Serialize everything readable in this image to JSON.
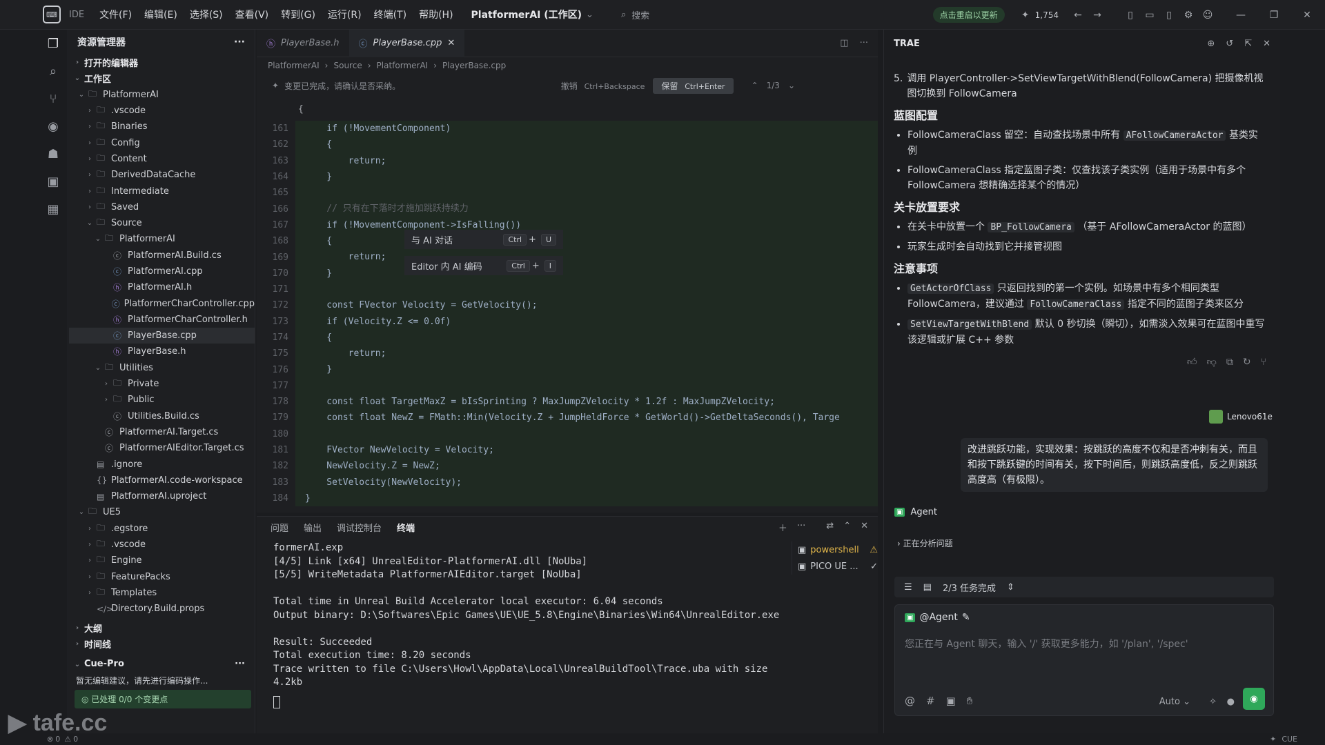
{
  "titlebar": {
    "ide_label": "IDE",
    "menu": [
      "文件(F)",
      "编辑(E)",
      "选择(S)",
      "查看(V)",
      "转到(G)",
      "运行(R)",
      "终端(T)",
      "帮助(H)"
    ],
    "project": "PlatformerAI (工作区)",
    "search": "搜索",
    "update": "点击重启以更新",
    "stars": "1,754"
  },
  "sidebar": {
    "title": "资源管理器",
    "open_editors": "打开的编辑器",
    "workspace": "工作区",
    "tree": [
      {
        "name": "PlatformerAI",
        "type": "folder",
        "indent": 1,
        "open": true
      },
      {
        "name": ".vscode",
        "type": "folder",
        "indent": 2
      },
      {
        "name": "Binaries",
        "type": "folder",
        "indent": 2
      },
      {
        "name": "Config",
        "type": "folder",
        "indent": 2
      },
      {
        "name": "Content",
        "type": "folder",
        "indent": 2
      },
      {
        "name": "DerivedDataCache",
        "type": "folder",
        "indent": 2
      },
      {
        "name": "Intermediate",
        "type": "folder",
        "indent": 2
      },
      {
        "name": "Saved",
        "type": "folder",
        "indent": 2
      },
      {
        "name": "Source",
        "type": "folder",
        "indent": 2,
        "open": true
      },
      {
        "name": "PlatformerAI",
        "type": "folder",
        "indent": 3,
        "open": true
      },
      {
        "name": "PlatformerAI.Build.cs",
        "type": "cs",
        "indent": 4
      },
      {
        "name": "PlatformerAI.cpp",
        "type": "cpp",
        "indent": 4
      },
      {
        "name": "PlatformerAI.h",
        "type": "h",
        "indent": 4
      },
      {
        "name": "PlatformerCharController.cpp",
        "type": "cpp",
        "indent": 4
      },
      {
        "name": "PlatformerCharController.h",
        "type": "h",
        "indent": 4
      },
      {
        "name": "PlayerBase.cpp",
        "type": "cpp",
        "indent": 4,
        "selected": true
      },
      {
        "name": "PlayerBase.h",
        "type": "h",
        "indent": 4
      },
      {
        "name": "Utilities",
        "type": "folder",
        "indent": 3,
        "open": true
      },
      {
        "name": "Private",
        "type": "folder",
        "indent": 4
      },
      {
        "name": "Public",
        "type": "folder",
        "indent": 4
      },
      {
        "name": "Utilities.Build.cs",
        "type": "cs",
        "indent": 4
      },
      {
        "name": "PlatformerAI.Target.cs",
        "type": "cs",
        "indent": 3
      },
      {
        "name": "PlatformerAIEditor.Target.cs",
        "type": "cs",
        "indent": 3
      },
      {
        "name": ".ignore",
        "type": "file",
        "indent": 2
      },
      {
        "name": "PlatformerAI.code-workspace",
        "type": "json",
        "indent": 2
      },
      {
        "name": "PlatformerAI.uproject",
        "type": "file",
        "indent": 2
      },
      {
        "name": "UE5",
        "type": "folder",
        "indent": 1,
        "open": true
      },
      {
        "name": ".egstore",
        "type": "folder",
        "indent": 2
      },
      {
        "name": ".vscode",
        "type": "folder",
        "indent": 2
      },
      {
        "name": "Engine",
        "type": "folder",
        "indent": 2
      },
      {
        "name": "FeaturePacks",
        "type": "folder",
        "indent": 2
      },
      {
        "name": "Templates",
        "type": "folder",
        "indent": 2
      },
      {
        "name": "Directory.Build.props",
        "type": "xml",
        "indent": 2
      }
    ],
    "outline": "大纲",
    "timeline": "时间线",
    "cue_pro": "Cue-Pro",
    "cue_msg": "暂无编辑建议，请先进行编码操作...",
    "cue_status": "已处理 0/0 个变更点"
  },
  "editor": {
    "tabs": [
      {
        "label": "PlayerBase.h",
        "active": false
      },
      {
        "label": "PlayerBase.cpp",
        "active": true
      }
    ],
    "breadcrumb": [
      "PlatformerAI",
      "Source",
      "PlatformerAI",
      "PlayerBase.cpp"
    ],
    "change_notice": "变更已完成，请确认是否采纳。",
    "undo_label": "撤销",
    "undo_key": "Ctrl+Backspace",
    "keep_label": "保留",
    "keep_key": "Ctrl+Enter",
    "change_count": "1/3",
    "code_lines": [
      {
        "n": "161",
        "t": "    if (!MovementComponent)"
      },
      {
        "n": "162",
        "t": "    {"
      },
      {
        "n": "163",
        "t": "        return;"
      },
      {
        "n": "164",
        "t": "    }"
      },
      {
        "n": "165",
        "t": ""
      },
      {
        "n": "166",
        "t": "    // 只有在下落时才施加跳跃持续力"
      },
      {
        "n": "167",
        "t": "    if (!MovementComponent->IsFalling())"
      },
      {
        "n": "168",
        "t": "    {"
      },
      {
        "n": "169",
        "t": "        return;"
      },
      {
        "n": "170",
        "t": "    }"
      },
      {
        "n": "171",
        "t": ""
      },
      {
        "n": "172",
        "t": "    const FVector Velocity = GetVelocity();"
      },
      {
        "n": "173",
        "t": "    if (Velocity.Z <= 0.0f)"
      },
      {
        "n": "174",
        "t": "    {"
      },
      {
        "n": "175",
        "t": "        return;"
      },
      {
        "n": "176",
        "t": "    }"
      },
      {
        "n": "177",
        "t": ""
      },
      {
        "n": "178",
        "t": "    const float TargetMaxZ = bIsSprinting ? MaxJumpZVelocity * 1.2f : MaxJumpZVelocity;"
      },
      {
        "n": "179",
        "t": "    const float NewZ = FMath::Min(Velocity.Z + JumpHeldForce * GetWorld()->GetDeltaSeconds(), Targe"
      },
      {
        "n": "180",
        "t": ""
      },
      {
        "n": "181",
        "t": "    FVector NewVelocity = Velocity;"
      },
      {
        "n": "182",
        "t": "    NewVelocity.Z = NewZ;"
      },
      {
        "n": "183",
        "t": "    SetVelocity(NewVelocity);"
      },
      {
        "n": "184",
        "t": "}"
      }
    ],
    "ctx_chat": "与 AI 对话",
    "ctx_chat_key": [
      "Ctrl",
      "U"
    ],
    "ctx_edit": "Editor 内 AI 编码",
    "ctx_edit_key": [
      "Ctrl",
      "I"
    ]
  },
  "panel": {
    "tabs": [
      "问题",
      "输出",
      "调试控制台",
      "终端"
    ],
    "active_tab": "终端",
    "terminal_lines": [
      "formerAI.exp",
      "[4/5] Link [x64] UnrealEditor-PlatformerAI.dll [NoUba]",
      "[5/5] WriteMetadata PlatformerAIEditor.target [NoUba]",
      "",
      "Total time in Unreal Build Accelerator local executor: 6.04 seconds",
      "Output binary: D:\\Softwares\\Epic Games\\UE\\UE_5.8\\Engine\\Binaries\\Win64\\UnrealEditor.exe",
      "",
      "Result: Succeeded",
      "Total execution time: 8.20 seconds",
      "Trace written to file C:\\Users\\Howl\\AppData\\Local\\UnrealBuildTool\\Trace.uba with size 4.2kb"
    ],
    "terminals": [
      "powershell",
      "PICO UE ..."
    ]
  },
  "ai": {
    "title": "TRAE",
    "step5": "调用 PlayerController->SetViewTargetWithBlend(FollowCamera) 把摄像机视图切换到 FollowCamera",
    "h_blueprint": "蓝图配置",
    "bp1_a": "FollowCameraClass 留空：自动查找场景中所有",
    "bp1_code": "AFollowCameraActor",
    "bp1_b": "基类实例",
    "bp2": "FollowCameraClass 指定蓝图子类：仅查找该子类实例（适用于场景中有多个 FollowCamera 想精确选择某个的情况）",
    "h_level": "关卡放置要求",
    "lv1_a": "在关卡中放置一个",
    "lv1_code": "BP_FollowCamera",
    "lv1_b": "（基于 AFollowCameraActor 的蓝图）",
    "lv2": "玩家生成时会自动找到它并接管视图",
    "h_notes": "注意事项",
    "nt1_code": "GetActorOfClass",
    "nt1_a": "只返回找到的第一个实例。如场景中有多个相同类型 FollowCamera，建议通过",
    "nt1_code2": "FollowCameraClass",
    "nt1_b": "指定不同的蓝图子类来区分",
    "nt2_code": "SetViewTargetWithBlend",
    "nt2_a": "默认 0 秒切换（瞬切），如需淡入效果可在蓝图中重写该逻辑或扩展 C++ 参数",
    "user_name": "Lenovo61e",
    "user_msg": "改进跳跃功能，实现效果：按跳跃的高度不仅和是否冲刺有关，而且和按下跳跃键的时间有关，按下时间后，则跳跃高度低，反之则跳跃高度高（有极限）。",
    "agent_label": "Agent",
    "analyzing": "正在分析问题",
    "task_status": "2/3 任务完成",
    "mention": "@Agent",
    "placeholder": "您正在与 Agent 聊天，输入 '/' 获取更多能力，如 '/plan', '/spec'",
    "auto_label": "Auto"
  },
  "status": {
    "errors": "0",
    "warnings": "0",
    "lang": "CUE"
  },
  "watermark": "tafe.cc",
  "colors": {
    "accent_green": "#2fa85a",
    "diff_bg": "#1f2a22"
  }
}
